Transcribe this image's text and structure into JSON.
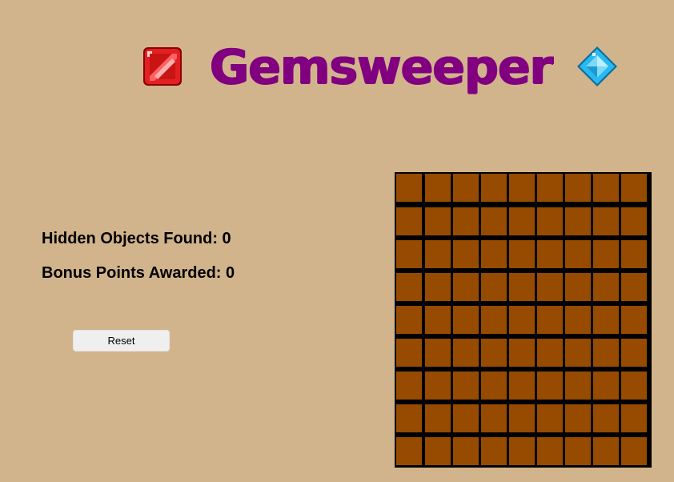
{
  "header": {
    "title": "Gemsweeper",
    "left_icon": "red-gem-icon",
    "right_icon": "blue-gem-icon"
  },
  "stats": {
    "hidden_objects_label": "Hidden Objects Found: ",
    "hidden_objects_value": "0",
    "bonus_points_label": "Bonus Points Awarded: ",
    "bonus_points_value": "0"
  },
  "controls": {
    "reset_label": "Reset"
  },
  "board": {
    "rows": 9,
    "cols": 9,
    "cell_color": "#964b00",
    "grid_color": "#000000"
  },
  "colors": {
    "background": "#d2b48c",
    "title": "#800080",
    "red_gem": "#e32020",
    "blue_gem": "#29b8f0"
  }
}
